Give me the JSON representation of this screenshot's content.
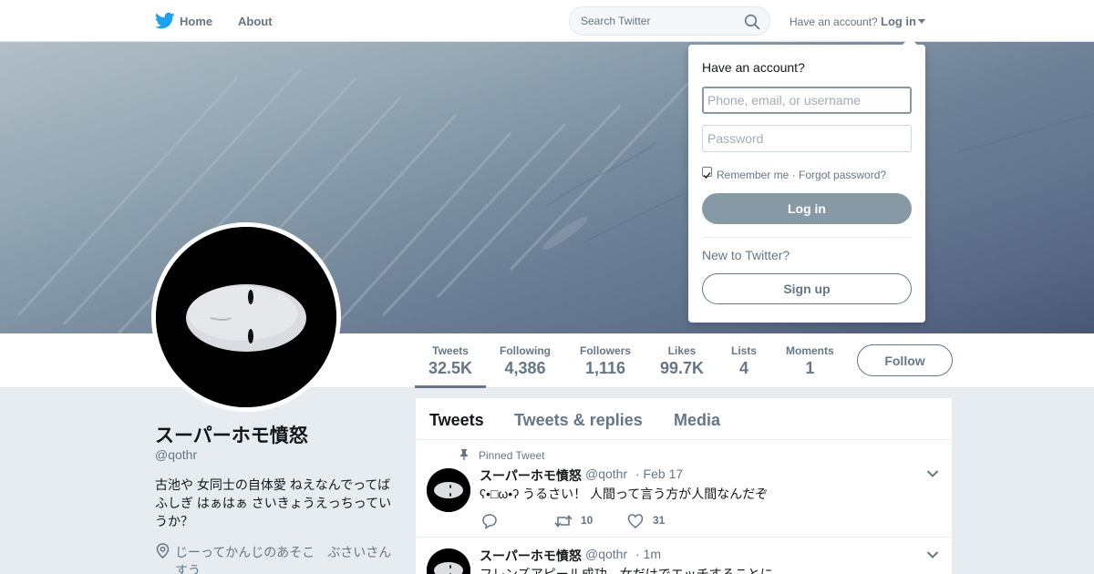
{
  "nav": {
    "logo_icon": "twitter-bird-icon",
    "home_label": "Home",
    "about_label": "About",
    "search_placeholder": "Search Twitter",
    "have_account": "Have an account?",
    "login_label": "Log in"
  },
  "stats": [
    {
      "label": "Tweets",
      "value": "32.5K"
    },
    {
      "label": "Following",
      "value": "4,386"
    },
    {
      "label": "Followers",
      "value": "1,116"
    },
    {
      "label": "Likes",
      "value": "99.7K"
    },
    {
      "label": "Lists",
      "value": "4"
    },
    {
      "label": "Moments",
      "value": "1"
    }
  ],
  "follow_label": "Follow",
  "profile": {
    "name": "スーパーホモ憤怒",
    "handle": "@qothr",
    "bio": "古池や 女同士の自体愛 ねえなんでってば ふしぎ はぁはぁ さいきょうえっちってい うか？",
    "location": "じーってかんじのあそこ　ぶさいさん すう"
  },
  "timeline": {
    "tabs": [
      "Tweets",
      "Tweets & replies",
      "Media"
    ],
    "tweets": [
      {
        "pinned_label": "Pinned Tweet",
        "name": "スーパーホモ憤怒",
        "handle": "@qothr",
        "time": "· Feb 17",
        "text": "ʕ•□ω•ʔ うるさい！ 人間って言う方が人間なんだぞ",
        "retweets": "10",
        "likes": "31"
      },
      {
        "name": "スーパーホモ憤怒",
        "handle": "@qothr",
        "time": "· 1m",
        "text": "フレンズアピール成功。女だけでエッチすることに"
      }
    ]
  },
  "login_dropdown": {
    "title": "Have an account?",
    "username_placeholder": "Phone, email, or username",
    "password_placeholder": "Password",
    "remember": "Remember me · Forgot password?",
    "login_button": "Log in",
    "new_to_twitter": "New to Twitter?",
    "signup_button": "Sign up"
  },
  "colors": {
    "accent": "#657786",
    "login_button": "#8899a6",
    "twitter_blue": "#1da1f2"
  }
}
